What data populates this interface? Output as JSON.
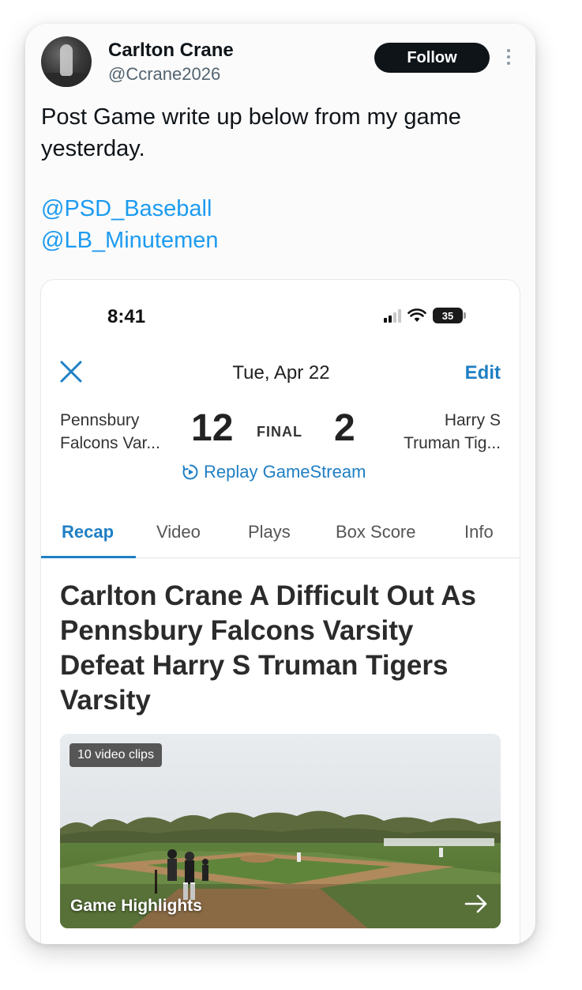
{
  "tweet": {
    "author_name": "Carlton Crane",
    "author_handle": "@Ccrane2026",
    "follow_label": "Follow",
    "text": "Post Game write up below from my game yesterday.",
    "mentions": [
      "@PSD_Baseball",
      "@LB_Minutemen"
    ]
  },
  "embedded": {
    "status_bar": {
      "time": "8:41",
      "battery": "35"
    },
    "header": {
      "date": "Tue, Apr 22",
      "edit_label": "Edit"
    },
    "game": {
      "home_team": "Pennsbury Falcons Var...",
      "home_team_lines": [
        "Pennsbury",
        "Falcons Var..."
      ],
      "home_score": "12",
      "status": "FINAL",
      "away_score": "2",
      "away_team_lines": [
        "Harry S",
        "Truman Tig..."
      ],
      "replay_label": "Replay GameStream"
    },
    "tabs": [
      "Recap",
      "Video",
      "Plays",
      "Box Score",
      "Info"
    ],
    "active_tab": "Recap",
    "headline": "Carlton Crane A Difficult Out As Pennsbury Falcons Varsity Defeat Harry S Truman Tigers Varsity",
    "video": {
      "badge": "10 video clips",
      "title": "Game Highlights"
    }
  },
  "colors": {
    "link": "#1d9bf0",
    "gc_blue": "#1f7fc4",
    "follow_bg": "#0f1419"
  }
}
